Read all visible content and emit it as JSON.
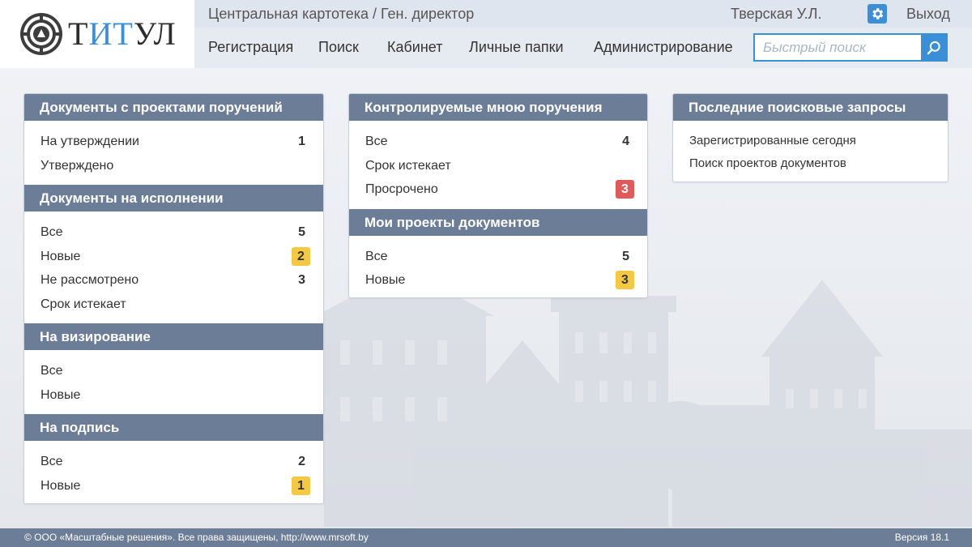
{
  "logo": {
    "text_a": "Т",
    "text_b": "ИТ",
    "text_c": "УЛ"
  },
  "header": {
    "breadcrumb": "Центральная картотека / Ген. директор",
    "user": "Тверская У.Л.",
    "logout": "Выход"
  },
  "nav": {
    "items": [
      {
        "label": "Регистрация"
      },
      {
        "label": "Поиск"
      },
      {
        "label": "Кабинет"
      },
      {
        "label": "Личные папки"
      },
      {
        "label": "Администрирование"
      }
    ]
  },
  "search": {
    "placeholder": "Быстрый поиск",
    "value": ""
  },
  "icons": {
    "gear": "gear-icon",
    "search": "magnifier-icon"
  },
  "colors": {
    "accent": "#3a8fd6",
    "panel_header": "#6c7d97",
    "badge_yellow": "#f5c842",
    "badge_red": "#e15a5a"
  },
  "left": {
    "s1": {
      "title": "Документы с проектами поручений",
      "rows": [
        {
          "label": "На утверждении",
          "count": "1"
        },
        {
          "label": "Утверждено",
          "count": ""
        }
      ]
    },
    "s2": {
      "title": "Документы на исполнении",
      "rows": [
        {
          "label": "Все",
          "count": "5"
        },
        {
          "label": "Новые",
          "count": "2"
        },
        {
          "label": "Не рассмотрено",
          "count": "3"
        },
        {
          "label": "Срок истекает",
          "count": ""
        }
      ]
    },
    "s3": {
      "title": "На визирование",
      "rows": [
        {
          "label": "Все",
          "count": ""
        },
        {
          "label": "Новые",
          "count": ""
        }
      ]
    },
    "s4": {
      "title": "На подпись",
      "rows": [
        {
          "label": "Все",
          "count": "2"
        },
        {
          "label": "Новые",
          "count": "1"
        }
      ]
    }
  },
  "middle": {
    "s1": {
      "title": "Контролируемые мною поручения",
      "rows": [
        {
          "label": "Все",
          "count": "4"
        },
        {
          "label": "Срок истекает",
          "count": ""
        },
        {
          "label": "Просрочено",
          "count": "3"
        }
      ]
    },
    "s2": {
      "title": "Мои проекты документов",
      "rows": [
        {
          "label": "Все",
          "count": "5"
        },
        {
          "label": "Новые",
          "count": "3"
        }
      ]
    }
  },
  "right": {
    "title": "Последние поисковые запросы",
    "rows": [
      {
        "label": "Зарегистрированные сегодня"
      },
      {
        "label": "Поиск проектов документов"
      }
    ]
  },
  "footer": {
    "copyright": "© ООО «Масштабные решения». Все права защищены, http://www.mrsoft.by",
    "version": "Версия 18.1"
  }
}
